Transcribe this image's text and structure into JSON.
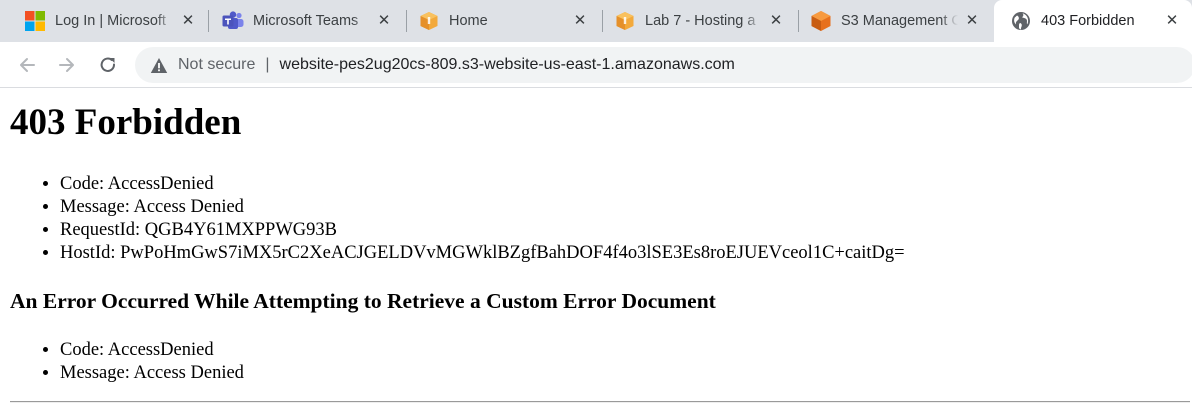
{
  "browser": {
    "tabs": [
      {
        "title": "Log In | Microsoft",
        "icon": "microsoft-logo-icon",
        "active": false
      },
      {
        "title": "Microsoft Teams",
        "icon": "microsoft-teams-icon",
        "active": false
      },
      {
        "title": "Home",
        "icon": "aws-box-icon",
        "active": false
      },
      {
        "title": "Lab 7 - Hosting a",
        "icon": "aws-box-icon",
        "active": false
      },
      {
        "title": "S3 Management C",
        "icon": "aws-s3-icon",
        "active": false
      },
      {
        "title": "403 Forbidden",
        "icon": "globe-icon",
        "active": true
      }
    ],
    "close_glyph": "✕",
    "address": {
      "security_label": "Not secure",
      "divider": "|",
      "url": "website-pes2ug20cs-809.s3-website-us-east-1.amazonaws.com"
    },
    "colors": {
      "tabstrip_bg": "#dee1e6",
      "omnibox_bg": "#f1f3f4",
      "aws_orange": "#f3a93b",
      "s3_orange": "#e7701d",
      "teams_purple": "#5059c9"
    }
  },
  "page": {
    "heading": "403 Forbidden",
    "details": [
      "Code: AccessDenied",
      "Message: Access Denied",
      "RequestId: QGB4Y61MXPPWG93B",
      "HostId: PwPoHmGwS7iMX5rC2XeACJGELDVvMGWklBZgfBahDOF4f4o3lSE3Es8roEJUEVceol1C+caitDg="
    ],
    "subheading": "An Error Occurred While Attempting to Retrieve a Custom Error Document",
    "sub_details": [
      "Code: AccessDenied",
      "Message: Access Denied"
    ]
  }
}
